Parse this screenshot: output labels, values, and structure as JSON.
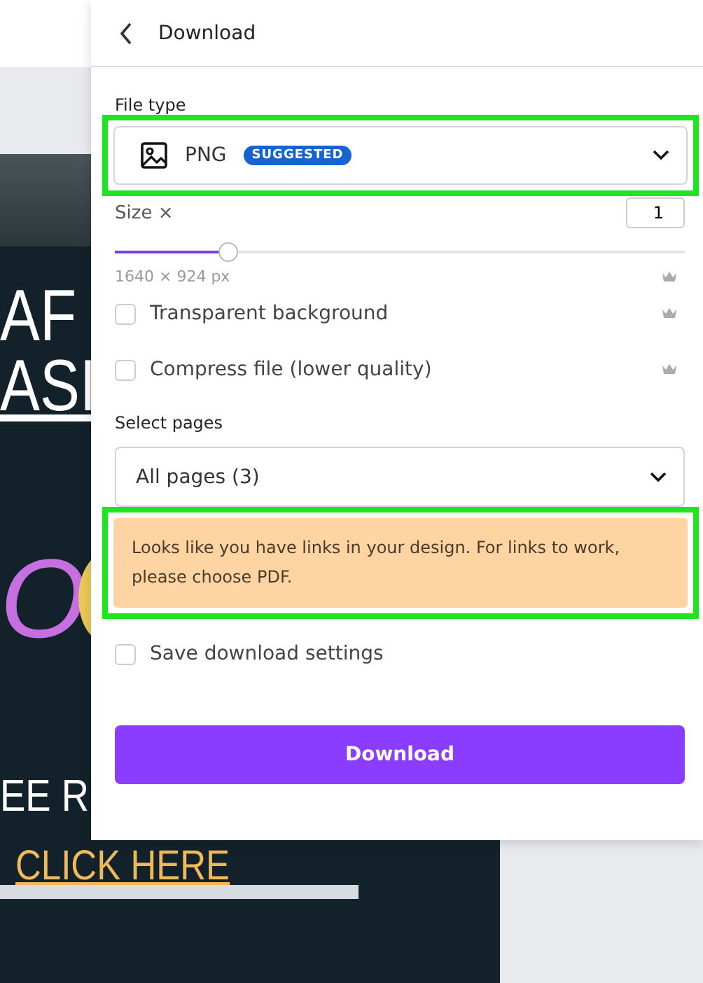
{
  "design": {
    "texts": [
      {
        "kind": "heading",
        "text": "AF"
      },
      {
        "kind": "underlined",
        "text": "ASI"
      },
      {
        "kind": "accent",
        "text": "O"
      },
      {
        "kind": "plain",
        "text": "EE R"
      },
      {
        "kind": "link",
        "text": "CLICK HERE"
      }
    ]
  },
  "panel": {
    "title": "Download",
    "file_type": {
      "label": "File type",
      "value": "PNG",
      "badge": "SUGGESTED",
      "highlighted": true
    },
    "size": {
      "label": "Size ×",
      "value": "1",
      "level": 0.2,
      "dimensions": "1640 × 924 px"
    },
    "options": [
      {
        "label": "Transparent background",
        "checked": false,
        "premium": true
      },
      {
        "label": "Compress file (lower quality)",
        "checked": false,
        "premium": true
      }
    ],
    "pages": {
      "label": "Select pages",
      "value": "All pages (3)"
    },
    "notice": {
      "text": "Looks like you have links in your design. For links to work, please choose PDF.",
      "highlighted": true
    },
    "save_settings": {
      "label": "Save download settings",
      "checked": false
    },
    "button": "Download"
  }
}
